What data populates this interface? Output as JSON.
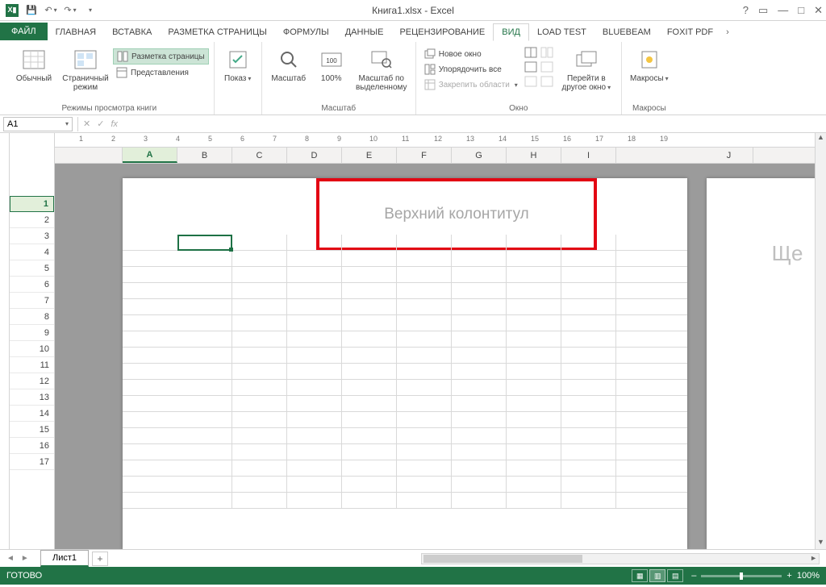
{
  "title": "Книга1.xlsx - Excel",
  "qat": {
    "excel": "X▮",
    "save": "💾",
    "undo": "↶",
    "redo": "↷"
  },
  "win": {
    "help": "?",
    "opts": "▭",
    "min": "—",
    "max": "□",
    "close": "✕",
    "rmin": "—",
    "rclose": "✕"
  },
  "tabs": {
    "file": "ФАЙЛ",
    "home": "ГЛАВНАЯ",
    "insert": "ВСТАВКА",
    "pagelayout": "РАЗМЕТКА СТРАНИЦЫ",
    "formulas": "ФОРМУЛЫ",
    "data": "ДАННЫЕ",
    "review": "РЕЦЕНЗИРОВАНИЕ",
    "view": "ВИД",
    "loadtest": "LOAD TEST",
    "bluebeam": "BLUEBEAM",
    "foxit": "Foxit PDF"
  },
  "ribbon": {
    "views": {
      "normal": "Обычный",
      "pagebreak": "Страничный режим",
      "pagelayout": "Разметка страницы",
      "custom": "Представления",
      "group": "Режимы просмотра книги"
    },
    "show": {
      "btn": "Показ"
    },
    "zoom": {
      "zoom": "Масштаб",
      "hundred": "100%",
      "selection": "Масштаб по выделенному",
      "group": "Масштаб"
    },
    "window": {
      "new": "Новое окно",
      "arrange": "Упорядочить все",
      "freeze": "Закрепить области",
      "switch": "Перейти в другое окно",
      "group": "Окно"
    },
    "macros": {
      "btn": "Макросы",
      "group": "Макросы"
    }
  },
  "namebox": "A1",
  "fx": {
    "cancel": "✕",
    "ok": "✓",
    "fx": "fx"
  },
  "ruler": [
    "1",
    "2",
    "3",
    "4",
    "5",
    "6",
    "7",
    "8",
    "9",
    "10",
    "11",
    "12",
    "13",
    "14",
    "15",
    "16",
    "17",
    "18",
    "19"
  ],
  "cols": [
    "A",
    "B",
    "C",
    "D",
    "E",
    "F",
    "G",
    "H",
    "I"
  ],
  "col_right": "J",
  "rows": [
    "1",
    "2",
    "3",
    "4",
    "5",
    "6",
    "7",
    "8",
    "9",
    "10",
    "11",
    "12",
    "13",
    "14",
    "15",
    "16",
    "17"
  ],
  "header_text": "Верхний колонтитул",
  "page2_text": "Ще",
  "sheet": {
    "name": "Лист1",
    "add": "+",
    "navL": "◄",
    "navR": "►"
  },
  "status": {
    "ready": "ГОТОВО",
    "zoom": "100%",
    "minus": "–",
    "plus": "+"
  }
}
